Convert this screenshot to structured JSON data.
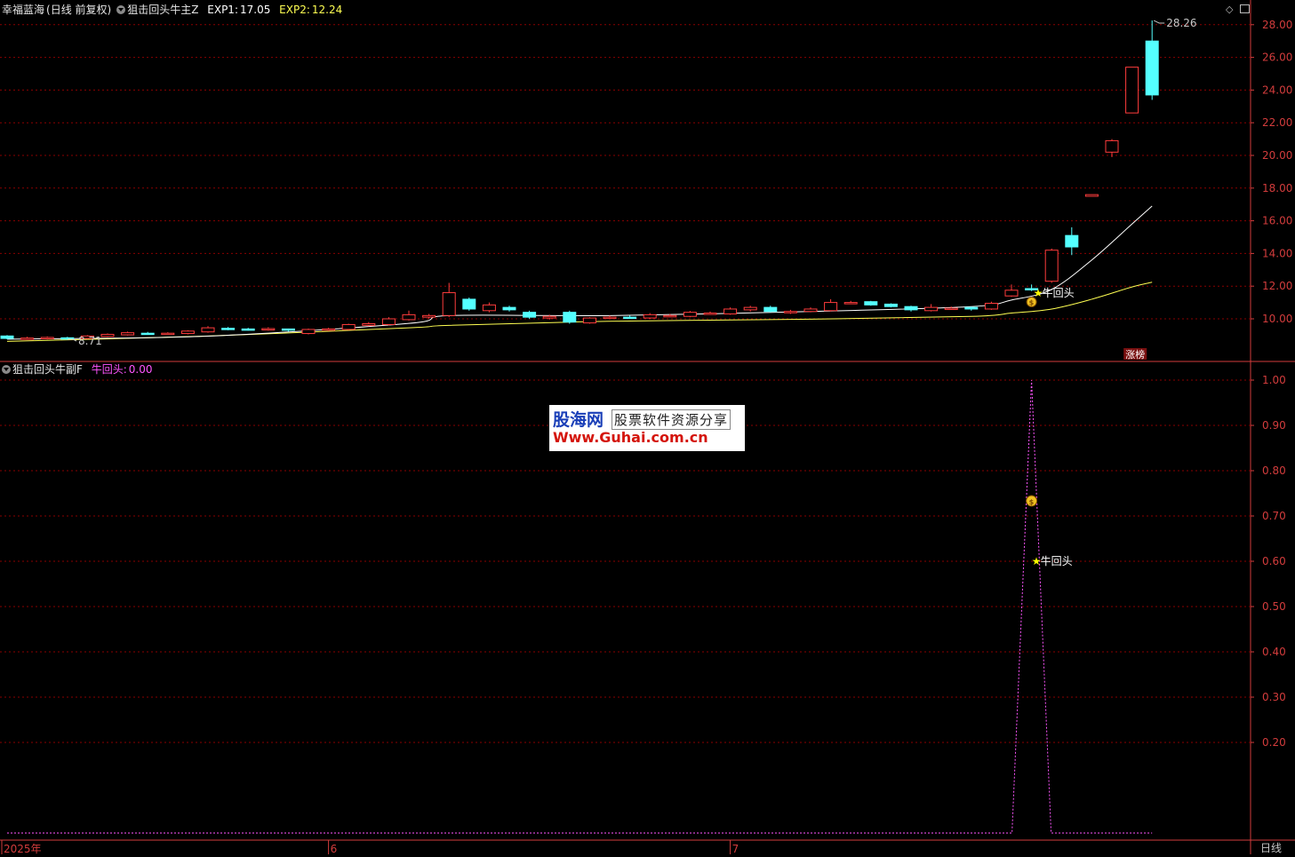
{
  "header_top": {
    "stock_name": "幸福蓝海",
    "mode": "(日线 前复权)",
    "indicator": "狙击回头牛主Z",
    "exp1_label": "EXP1:",
    "exp1_value": "17.05",
    "exp2_label": "EXP2:",
    "exp2_value": "12.24"
  },
  "header_bottom": {
    "indicator": "狙击回头牛副F",
    "signal_label": "牛回头:",
    "signal_value": "0.00"
  },
  "watermark": {
    "line1_brand": "股海网",
    "line1_slogan": "股票软件资源分享",
    "line2": "Www.Guhai.com.cn"
  },
  "period_label": "日线",
  "top_right_icons": [
    "diamond-icon",
    "window-icon"
  ],
  "colors": {
    "up": "#ff3c3c",
    "down": "#54ffff",
    "grid": "#8a0000",
    "axis_text": "#d23c3c",
    "ma_fast": "#ffffff",
    "ma_slow": "#ffff52",
    "signal_line": "#ff55ff",
    "label_yellow": "#ffff00"
  },
  "chart_data": [
    {
      "type": "candlestick",
      "ylim": [
        8.5,
        28.8
      ],
      "yticks": [
        "10.00",
        "12.00",
        "14.00",
        "16.00",
        "18.00",
        "20.00",
        "22.00",
        "24.00",
        "26.00",
        "28.00"
      ],
      "x_labels": [
        {
          "index": 0,
          "label": "2025年"
        },
        {
          "index": 16,
          "label": "6"
        },
        {
          "index": 36,
          "label": "7"
        }
      ],
      "annotations": {
        "high_label": "28.26",
        "low_label": "8.71",
        "signal_text": "牛回头",
        "badge_text": "涨榜"
      },
      "candles": [
        [
          8.95,
          8.8,
          9.0,
          8.75
        ],
        [
          8.78,
          8.82,
          8.9,
          8.72
        ],
        [
          8.8,
          8.86,
          8.92,
          8.74
        ],
        [
          8.84,
          8.8,
          8.9,
          8.71
        ],
        [
          8.8,
          8.95,
          9.0,
          8.76
        ],
        [
          8.92,
          9.05,
          9.1,
          8.88
        ],
        [
          9.02,
          9.15,
          9.22,
          8.98
        ],
        [
          9.12,
          9.1,
          9.2,
          9.02
        ],
        [
          9.08,
          9.12,
          9.18,
          9.02
        ],
        [
          9.1,
          9.25,
          9.3,
          9.05
        ],
        [
          9.2,
          9.45,
          9.55,
          9.15
        ],
        [
          9.42,
          9.4,
          9.5,
          9.3
        ],
        [
          9.38,
          9.35,
          9.45,
          9.28
        ],
        [
          9.35,
          9.4,
          9.48,
          9.28
        ],
        [
          9.38,
          9.3,
          9.4,
          9.22
        ],
        [
          9.1,
          9.35,
          9.4,
          9.05
        ],
        [
          9.32,
          9.38,
          9.45,
          9.25
        ],
        [
          9.35,
          9.65,
          9.7,
          9.3
        ],
        [
          9.6,
          9.7,
          9.8,
          9.55
        ],
        [
          9.65,
          10.0,
          10.1,
          9.6
        ],
        [
          9.95,
          10.25,
          10.5,
          9.9
        ],
        [
          10.1,
          10.2,
          10.3,
          10.0
        ],
        [
          10.2,
          11.6,
          12.2,
          10.1
        ],
        [
          11.2,
          10.6,
          11.3,
          10.5
        ],
        [
          10.5,
          10.85,
          11.0,
          10.4
        ],
        [
          10.7,
          10.55,
          10.8,
          10.45
        ],
        [
          10.4,
          10.1,
          10.5,
          10.0
        ],
        [
          10.05,
          10.15,
          10.25,
          9.95
        ],
        [
          10.4,
          9.8,
          10.5,
          9.7
        ],
        [
          9.75,
          10.05,
          10.1,
          9.7
        ],
        [
          10.05,
          10.1,
          10.2,
          9.98
        ],
        [
          10.1,
          10.05,
          10.2,
          10.0
        ],
        [
          10.05,
          10.25,
          10.35,
          10.0
        ],
        [
          10.2,
          10.2,
          10.3,
          10.1
        ],
        [
          10.15,
          10.4,
          10.48,
          10.1
        ],
        [
          10.35,
          10.35,
          10.45,
          10.25
        ],
        [
          10.3,
          10.6,
          10.7,
          10.25
        ],
        [
          10.55,
          10.7,
          10.8,
          10.45
        ],
        [
          10.7,
          10.45,
          10.8,
          10.4
        ],
        [
          10.4,
          10.45,
          10.55,
          10.3
        ],
        [
          10.45,
          10.6,
          10.7,
          10.4
        ],
        [
          10.5,
          11.0,
          11.2,
          10.45
        ],
        [
          11.0,
          11.0,
          11.1,
          10.9
        ],
        [
          11.05,
          10.85,
          11.1,
          10.8
        ],
        [
          10.9,
          10.75,
          10.95,
          10.7
        ],
        [
          10.75,
          10.55,
          10.8,
          10.45
        ],
        [
          10.5,
          10.7,
          10.9,
          10.45
        ],
        [
          10.6,
          10.65,
          10.75,
          10.55
        ],
        [
          10.7,
          10.6,
          10.75,
          10.5
        ],
        [
          10.6,
          10.95,
          11.05,
          10.55
        ],
        [
          11.4,
          11.75,
          12.1,
          11.35
        ],
        [
          11.85,
          11.8,
          12.1,
          11.7
        ],
        [
          12.3,
          14.2,
          14.3,
          12.2
        ],
        [
          15.1,
          14.4,
          15.6,
          13.9
        ],
        [
          17.5,
          17.6,
          17.6,
          17.5
        ],
        [
          20.2,
          20.9,
          21.0,
          19.9
        ],
        [
          22.6,
          25.4,
          25.4,
          22.6
        ],
        [
          27.0,
          23.7,
          28.26,
          23.4
        ]
      ],
      "ma_fast_points": [
        [
          0,
          8.76
        ],
        [
          10,
          8.94
        ],
        [
          20,
          9.72
        ],
        [
          22,
          10.2
        ],
        [
          30,
          10.2
        ],
        [
          40,
          10.45
        ],
        [
          48,
          10.75
        ],
        [
          50,
          11.15
        ],
        [
          52,
          11.8
        ],
        [
          54,
          13.6
        ],
        [
          56,
          15.8
        ],
        [
          57,
          16.9
        ]
      ],
      "ma_slow_points": [
        [
          0,
          8.62
        ],
        [
          10,
          8.95
        ],
        [
          20,
          9.45
        ],
        [
          22,
          9.6
        ],
        [
          30,
          9.85
        ],
        [
          40,
          9.98
        ],
        [
          48,
          10.15
        ],
        [
          50,
          10.35
        ],
        [
          52,
          10.6
        ],
        [
          54,
          11.2
        ],
        [
          56,
          11.95
        ],
        [
          57,
          12.24
        ]
      ]
    },
    {
      "type": "line",
      "ylim": [
        0,
        1.05
      ],
      "yticks": [
        "0.20",
        "0.30",
        "0.40",
        "0.50",
        "0.60",
        "0.70",
        "0.80",
        "0.90",
        "1.00"
      ],
      "signal_index": 51,
      "signal_value": 1.0,
      "annotations": {
        "signal_text": "牛回头"
      }
    }
  ]
}
